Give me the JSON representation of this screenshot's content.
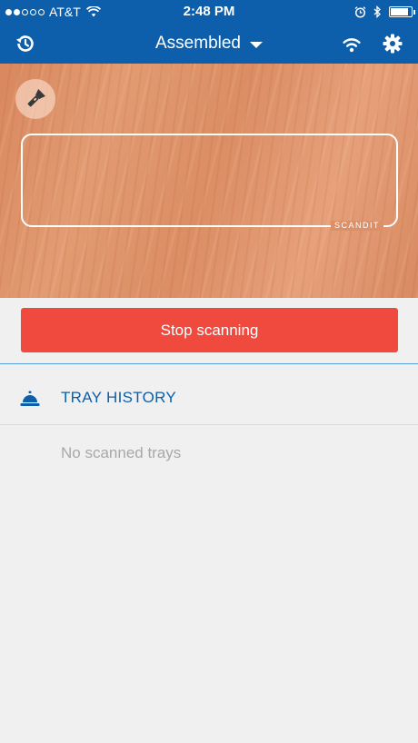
{
  "status_bar": {
    "carrier": "AT&T",
    "time": "2:48 PM",
    "signal_bars_filled": 2,
    "signal_bars_total": 5,
    "battery_level": 0.9
  },
  "nav": {
    "title": "Assembled",
    "left_icon": "history-icon",
    "right_icons": [
      "wifi-icon",
      "gear-icon"
    ]
  },
  "camera": {
    "torch_icon": "flashlight-icon",
    "watermark": "SCANDIT"
  },
  "actions": {
    "stop_scanning_label": "Stop scanning"
  },
  "tray_history": {
    "title": "TRAY HISTORY",
    "icon": "bell-icon",
    "empty_text": "No scanned trays"
  },
  "colors": {
    "brand_blue": "#0d5eab",
    "stop_red": "#ef4a3d",
    "empty_gray": "#a8a8a8"
  }
}
